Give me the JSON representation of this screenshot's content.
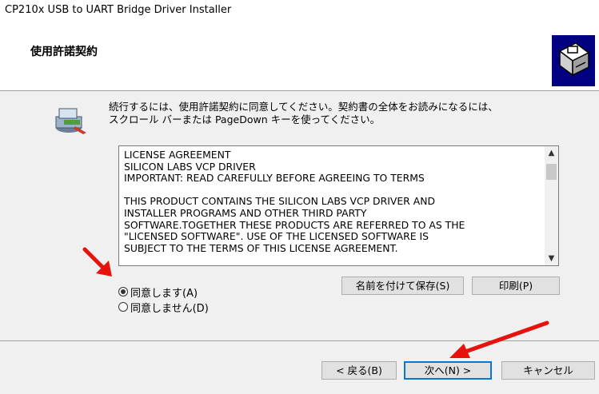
{
  "window": {
    "title": "CP210x USB to UART Bridge Driver Installer"
  },
  "header": {
    "title": "使用許諾契約"
  },
  "main": {
    "instructions": "続行するには、使用許諾契約に同意してください。契約書の全体をお読みになるには、\nスクロール バーまたは PageDown キーを使ってください。",
    "license_text": "LICENSE AGREEMENT\nSILICON LABS VCP DRIVER\nIMPORTANT:  READ CAREFULLY BEFORE AGREEING TO TERMS\n\nTHIS PRODUCT CONTAINS THE SILICON LABS VCP DRIVER AND\nINSTALLER PROGRAMS AND OTHER THIRD PARTY\nSOFTWARE.TOGETHER THESE PRODUCTS ARE REFERRED TO AS THE\n\"LICENSED SOFTWARE\". USE OF THE LICENSED SOFTWARE IS\nSUBJECT TO THE TERMS OF THIS LICENSE AGREEMENT.",
    "save_label": "名前を付けて保存(S)",
    "print_label": "印刷(P)",
    "radio_agree": {
      "label": "同意します(A)",
      "checked": true
    },
    "radio_disagree": {
      "label": "同意しません(D)",
      "checked": false
    }
  },
  "footer": {
    "back_label": "< 戻る(B)",
    "next_label": "次へ(N) >",
    "cancel_label": "キャンセル"
  },
  "colors": {
    "annotation_arrow": "#e8120c",
    "default_button_border": "#0078d7"
  },
  "icons": [
    "installer-logo-icon",
    "info-icon",
    "scroll-up-icon",
    "scroll-down-icon",
    "annotation-arrow"
  ]
}
